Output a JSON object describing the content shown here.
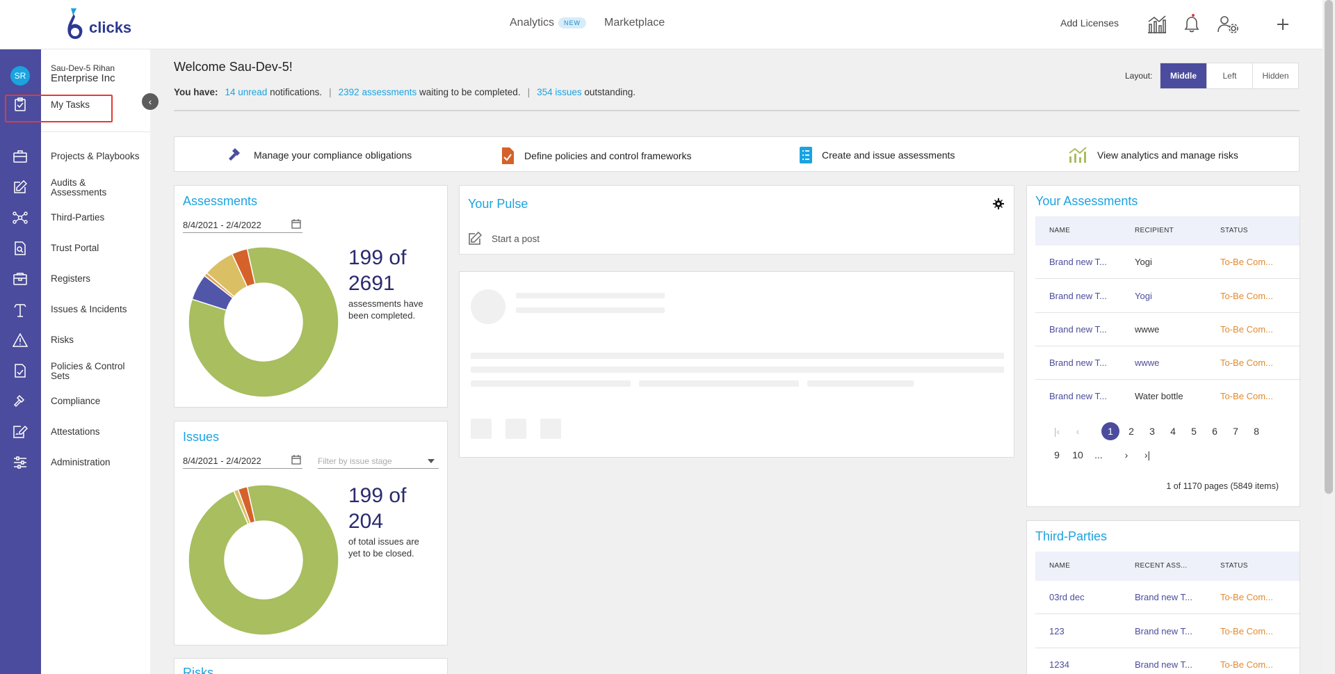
{
  "brand": {
    "logo_text": "clicks",
    "logo_icon": "six-logo-icon"
  },
  "topnav": {
    "analytics": "Analytics",
    "analytics_badge": "NEW",
    "marketplace": "Marketplace",
    "add_licenses": "Add Licenses"
  },
  "user": {
    "initials": "SR",
    "name": "Sau-Dev-5 Rihan",
    "org": "Enterprise Inc"
  },
  "sidebar": {
    "items": [
      {
        "label": "My Tasks",
        "icon": "clipboard-check-icon"
      },
      {
        "label": "Projects & Playbooks",
        "icon": "briefcase-icon"
      },
      {
        "label": "Audits & Assessments",
        "icon": "edit-square-icon"
      },
      {
        "label": "Third-Parties",
        "icon": "network-icon"
      },
      {
        "label": "Trust Portal",
        "icon": "document-search-icon"
      },
      {
        "label": "Registers",
        "icon": "register-box-icon"
      },
      {
        "label": "Issues & Incidents",
        "icon": "tool-icon"
      },
      {
        "label": "Risks",
        "icon": "warning-icon"
      },
      {
        "label": "Policies & Control Sets",
        "icon": "policy-icon"
      },
      {
        "label": "Compliance",
        "icon": "gavel-icon"
      },
      {
        "label": "Attestations",
        "icon": "signature-icon"
      },
      {
        "label": "Administration",
        "icon": "sliders-icon"
      }
    ]
  },
  "welcome": {
    "title": "Welcome Sau-Dev-5!",
    "you_have": "You have:",
    "notif_link": "14 unread",
    "notif_text": "notifications.",
    "assess_link": "2392 assessments",
    "assess_text": "waiting to be completed.",
    "issues_link": "354 issues",
    "issues_text": "outstanding."
  },
  "layout": {
    "label": "Layout:",
    "options": [
      "Middle",
      "Left",
      "Hidden"
    ],
    "active": "Middle"
  },
  "quick_actions": [
    {
      "label": "Manage your compliance obligations",
      "icon": "gavel-icon"
    },
    {
      "label": "Define policies and control frameworks",
      "icon": "policy-doc-icon"
    },
    {
      "label": "Create and issue assessments",
      "icon": "checklist-icon"
    },
    {
      "label": "View analytics and manage risks",
      "icon": "analytics-icon"
    }
  ],
  "assessments_card": {
    "title": "Assessments",
    "date_range": "8/4/2021 - 2/4/2022",
    "stat_line1": "199 of",
    "stat_line2": "2691",
    "stat_sub": "assessments have been completed.",
    "donut": [
      {
        "label": "completed",
        "value": 2216,
        "color": "#a8be5f"
      },
      {
        "label": "segment-2",
        "value": 150,
        "color": "#5256a9"
      },
      {
        "label": "segment-3",
        "value": 20,
        "color": "#e1a257"
      },
      {
        "label": "segment-4",
        "value": 180,
        "color": "#dbbf64"
      },
      {
        "label": "segment-5",
        "value": 90,
        "color": "#d4622a"
      }
    ]
  },
  "issues_card": {
    "title": "Issues",
    "date_range": "8/4/2021 - 2/4/2022",
    "filter_placeholder": "Filter by issue stage",
    "stat_line1": "199 of",
    "stat_line2": "204",
    "stat_sub": "of total issues are yet to be closed.",
    "donut": [
      {
        "label": "open",
        "value": 195,
        "color": "#a8be5f"
      },
      {
        "label": "segment-2",
        "value": 2,
        "color": "#dbbf64"
      },
      {
        "label": "segment-3",
        "value": 4,
        "color": "#d4622a"
      }
    ]
  },
  "risks_card": {
    "title": "Risks"
  },
  "pulse": {
    "title": "Your Pulse",
    "start_post": "Start a post"
  },
  "your_assessments": {
    "title": "Your Assessments",
    "columns": [
      "NAME",
      "RECIPIENT",
      "STATUS"
    ],
    "rows": [
      [
        "Brand new T...",
        "Yogi",
        "To-Be Com..."
      ],
      [
        "Brand new T...",
        "Yogi",
        "To-Be Com..."
      ],
      [
        "Brand new T...",
        "wwwe",
        "To-Be Com..."
      ],
      [
        "Brand new T...",
        "wwwe",
        "To-Be Com..."
      ],
      [
        "Brand new T...",
        "Water bottle",
        "To-Be Com..."
      ]
    ],
    "pages_row1": [
      "1",
      "2",
      "3",
      "4",
      "5",
      "6",
      "7",
      "8"
    ],
    "pages_row2": [
      "9",
      "10",
      "..."
    ],
    "page_info": "1 of 1170 pages (5849 items)"
  },
  "third_parties": {
    "title": "Third-Parties",
    "columns": [
      "NAME",
      "RECENT ASS...",
      "STATUS"
    ],
    "rows": [
      [
        "03rd dec",
        "Brand new T...",
        "To-Be Com..."
      ],
      [
        "123",
        "Brand new T...",
        "To-Be Com..."
      ],
      [
        "1234",
        "Brand new T...",
        "To-Be Com..."
      ]
    ]
  }
}
